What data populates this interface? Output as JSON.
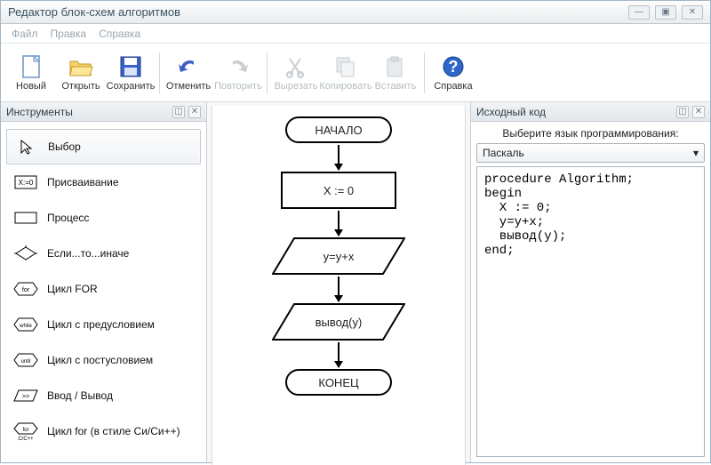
{
  "window": {
    "title": "Редактор блок-схем алгоритмов",
    "controls": {
      "min": "—",
      "max": "▣",
      "close": "✕"
    }
  },
  "menubar": [
    "Файл",
    "Правка",
    "Справка"
  ],
  "toolbar": {
    "new": "Новый",
    "open": "Открыть",
    "save": "Сохранить",
    "undo": "Отменить",
    "redo": "Повторить",
    "cut": "Вырезать",
    "copy": "Копировать",
    "paste": "Вставить",
    "help": "Справка"
  },
  "tools": {
    "title": "Инструменты",
    "items": [
      {
        "label": "Выбор",
        "selected": true
      },
      {
        "label": "Присваивание"
      },
      {
        "label": "Процесс"
      },
      {
        "label": "Если...то...иначе"
      },
      {
        "label": "Цикл FOR"
      },
      {
        "label": "Цикл с предусловием"
      },
      {
        "label": "Цикл с постусловием"
      },
      {
        "label": "Ввод / Вывод"
      },
      {
        "label": "Цикл for (в стиле Си/Си++)"
      }
    ]
  },
  "flowchart": {
    "start": "НАЧАЛО",
    "assign": "X := 0",
    "process": "y=y+x",
    "io": "вывод(y)",
    "end": "КОНЕЦ"
  },
  "source": {
    "title": "Исходный код",
    "lang_label": "Выберите язык программирования:",
    "lang_value": "Паскаль",
    "code": "procedure Algorithm;\nbegin\n  X := 0;\n  y=y+x;\n  вывод(y);\nend;"
  }
}
